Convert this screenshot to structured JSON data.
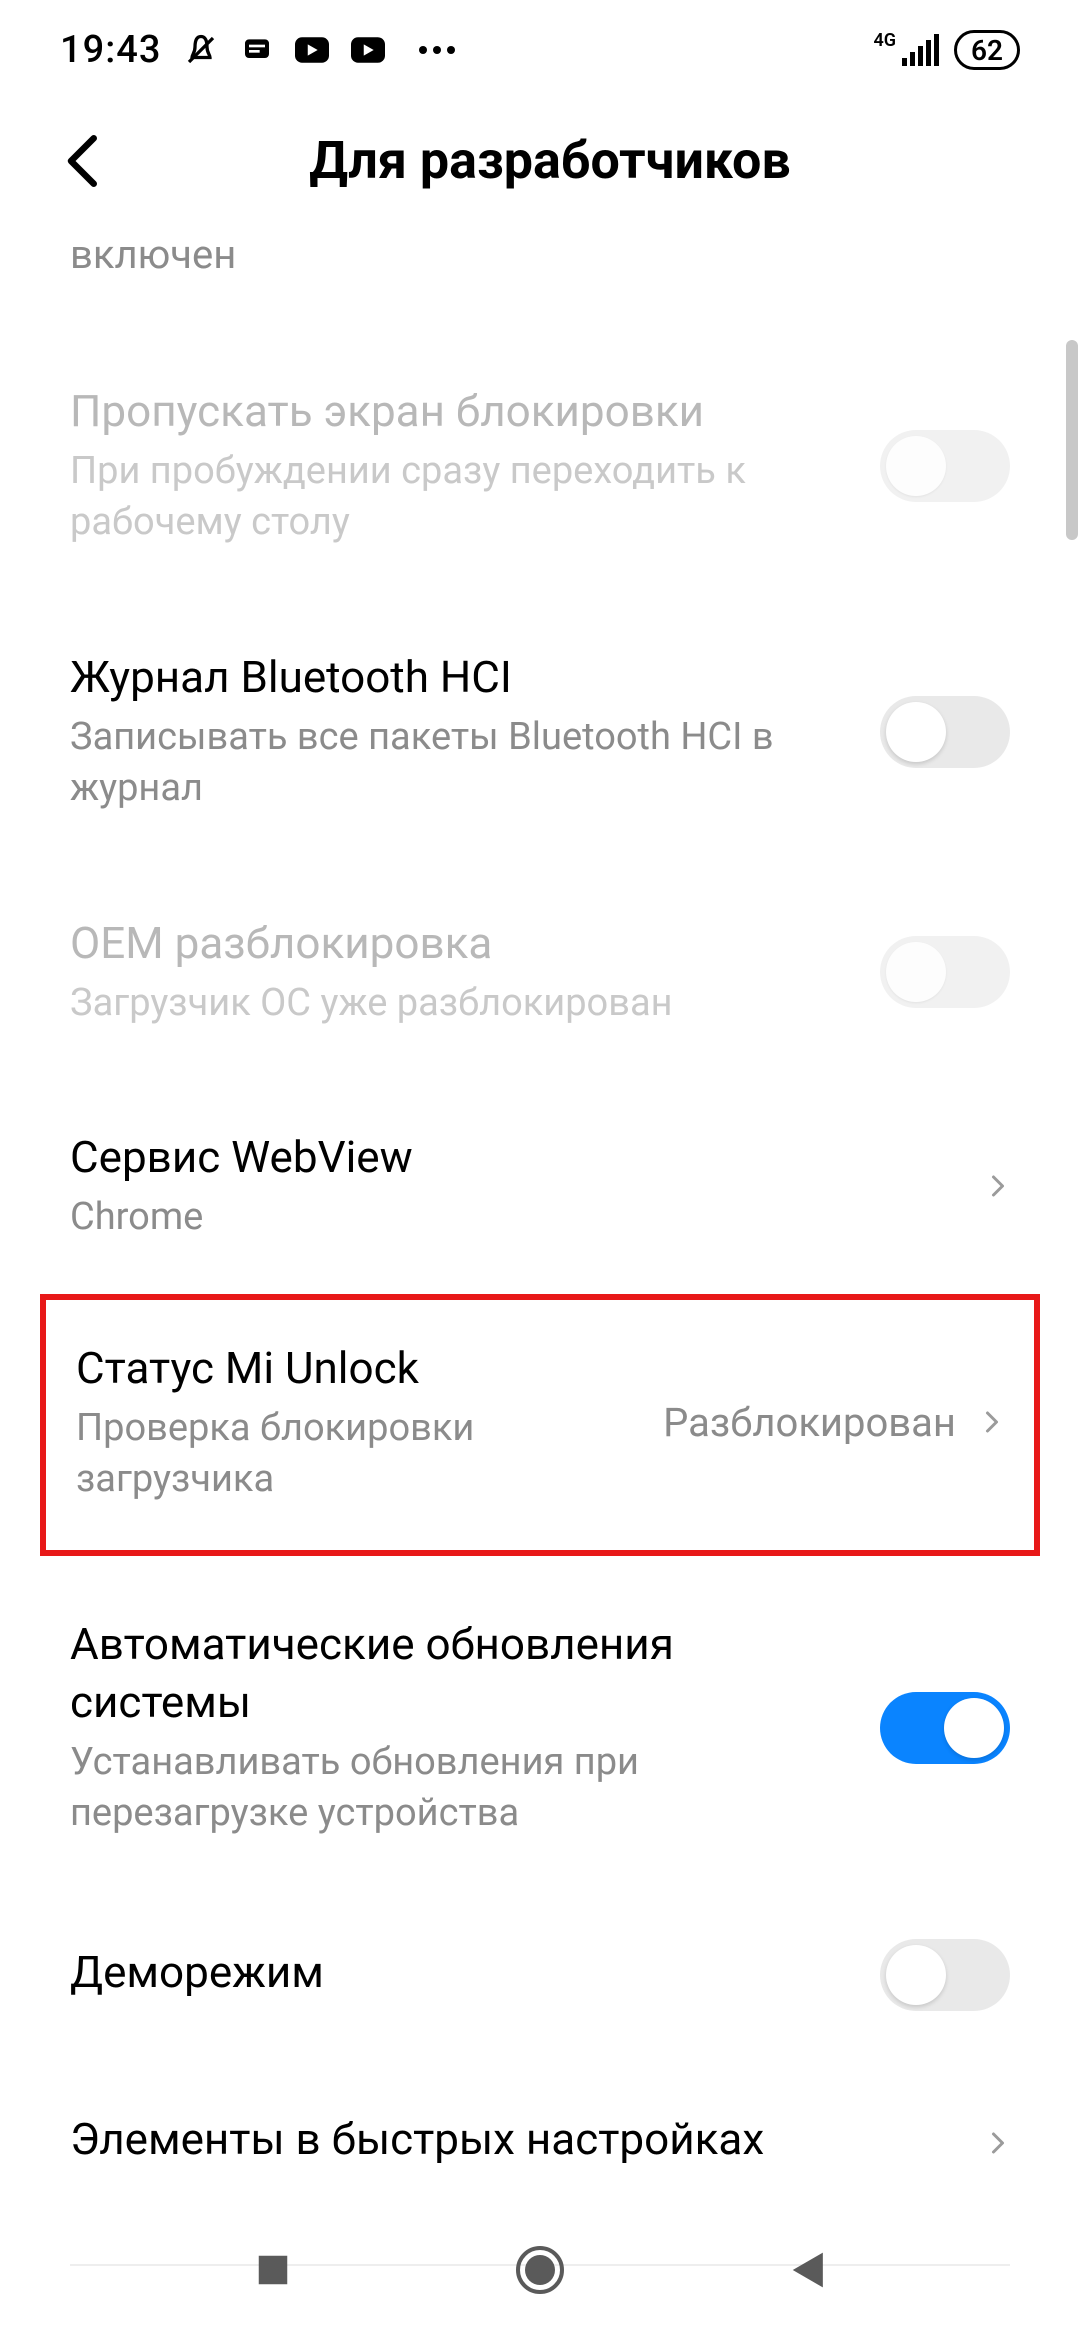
{
  "status_bar": {
    "time": "19:43",
    "network_label": "4G",
    "battery": "62"
  },
  "header": {
    "title": "Для разработчиков"
  },
  "prev_row_tail": "включен",
  "rows": {
    "skip_lock": {
      "title": "Пропускать экран блокировки",
      "sub": "При пробуждении сразу переходить к рабочему столу"
    },
    "bt_hci": {
      "title": "Журнал Bluetooth HCI",
      "sub": "Записывать все пакеты Bluetooth HCI в журнал"
    },
    "oem_unlock": {
      "title": "OEM разблокировка",
      "sub": "Загрузчик ОС уже разблокирован"
    },
    "webview": {
      "title": "Сервис WebView",
      "sub": "Chrome"
    },
    "mi_unlock": {
      "title": "Статус Mi Unlock",
      "sub": "Проверка блокировки загрузчика",
      "value": "Разблокирован"
    },
    "auto_update": {
      "title": "Автоматические обновления системы",
      "sub": "Устанавливать обновления при перезагрузке устройства"
    },
    "demo_mode": {
      "title": "Деморежим"
    },
    "quick_settings": {
      "title": "Элементы в быстрых настройках"
    }
  }
}
